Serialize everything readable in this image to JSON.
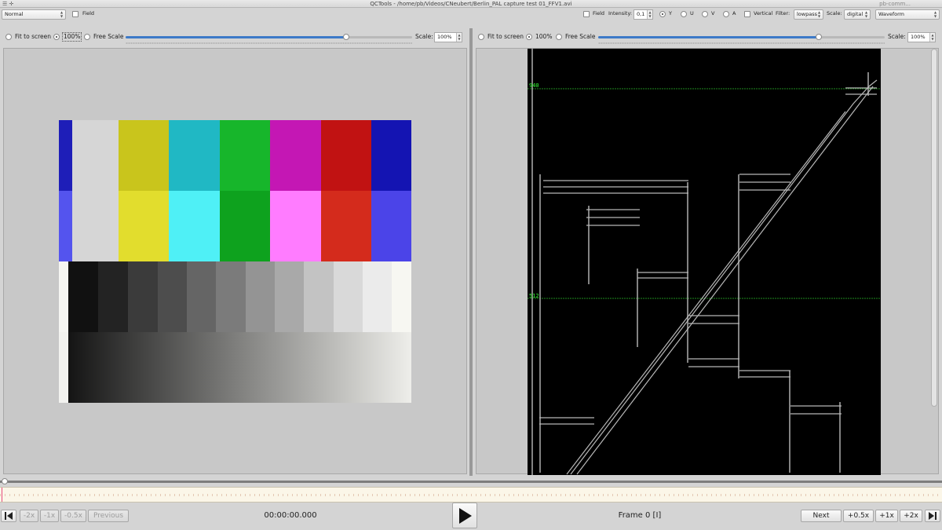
{
  "window": {
    "title": "QCTools - /home/pb/Videos/CNeubert/Berlin_PAL capture test 01_FFV1.avi",
    "menu_icons": "☰ ✛",
    "right_ghost": "pb-comm..."
  },
  "toolbar": {
    "left_mode": "Normal",
    "left_field_label": "Field",
    "right_field_label": "Field",
    "intensity_label": "Intensity:",
    "intensity_value": "0,1",
    "plane_y": "Y",
    "plane_u": "U",
    "plane_v": "V",
    "plane_a": "A",
    "vertical_label": "Vertical",
    "filter_label": "Filter:",
    "filter_value": "lowpass",
    "scale_label": "Scale:",
    "scale_value": "digital",
    "view_value": "Waveform"
  },
  "left_panel": {
    "fit_label": "Fit to screen",
    "pct_label": "100%",
    "free_label": "Free Scale",
    "scale_label": "Scale:",
    "scale_value": "100%",
    "slider_level": 0.77
  },
  "right_panel": {
    "fit_label": "Fit to screen",
    "pct_label": "100%",
    "free_label": "Free Scale",
    "scale_label": "Scale:",
    "scale_value": "100%",
    "slider_level": 0.77,
    "waveform_labels": [
      "940",
      "512"
    ]
  },
  "transport": {
    "btn_neg2": "-2x",
    "btn_neg1": "-1x",
    "btn_neg05": "-0.5x",
    "btn_prev": "Previous",
    "timecode": "00:00:00.000",
    "frame_label": "Frame 0 [I]",
    "btn_next": "Next",
    "btn_pos05": "+0.5x",
    "btn_pos1": "+1x",
    "btn_pos2": "+2x"
  },
  "colors": {
    "accent": "#3d7ac8",
    "waveform_ref": "#2db82d",
    "waveform_label": "#35ff35"
  }
}
